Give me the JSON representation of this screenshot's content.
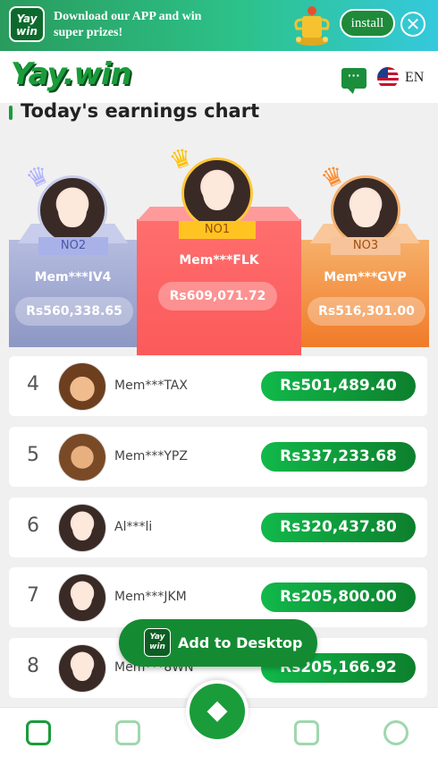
{
  "banner": {
    "app_logo_text": "Yay win",
    "text": "Download our APP and win super prizes!",
    "install_label": "install",
    "close_glyph": "✕"
  },
  "header": {
    "logo": "Yay.win",
    "chat_icon": "chat-icon",
    "flag_icon": "us-flag-icon",
    "language": "EN"
  },
  "section": {
    "title": "Today's earnings chart"
  },
  "podium": {
    "first": {
      "badge": "NO1",
      "name": "Mem***FLK",
      "amount": "Rs609,071.72"
    },
    "second": {
      "badge": "NO2",
      "name": "Mem***IV4",
      "amount": "Rs560,338.65"
    },
    "third": {
      "badge": "NO3",
      "name": "Mem***GVP",
      "amount": "Rs516,301.00"
    }
  },
  "ranking": [
    {
      "rank": "4",
      "name": "Mem***TAX",
      "amount": "Rs501,489.40"
    },
    {
      "rank": "5",
      "name": "Mem***YPZ",
      "amount": "Rs337,233.68"
    },
    {
      "rank": "6",
      "name": "Al***li",
      "amount": "Rs320,437.80"
    },
    {
      "rank": "7",
      "name": "Mem***JKM",
      "amount": "Rs205,800.00"
    },
    {
      "rank": "8",
      "name": "Mem***8WN",
      "amount": "Rs205,166.92"
    }
  ],
  "add_to_desktop": {
    "logo_text": "Yay win",
    "label": "Add to Desktop"
  },
  "nav": {
    "items": [
      "home-icon",
      "activity-icon",
      "promotion-icon",
      "wallet-icon",
      "account-icon"
    ],
    "colors": {
      "active": "#1a9c3a",
      "inactive": "#9fd7ad"
    }
  },
  "colors": {
    "brand_green": "#1a9c3a",
    "amount_pill": "#0d7f2d"
  }
}
